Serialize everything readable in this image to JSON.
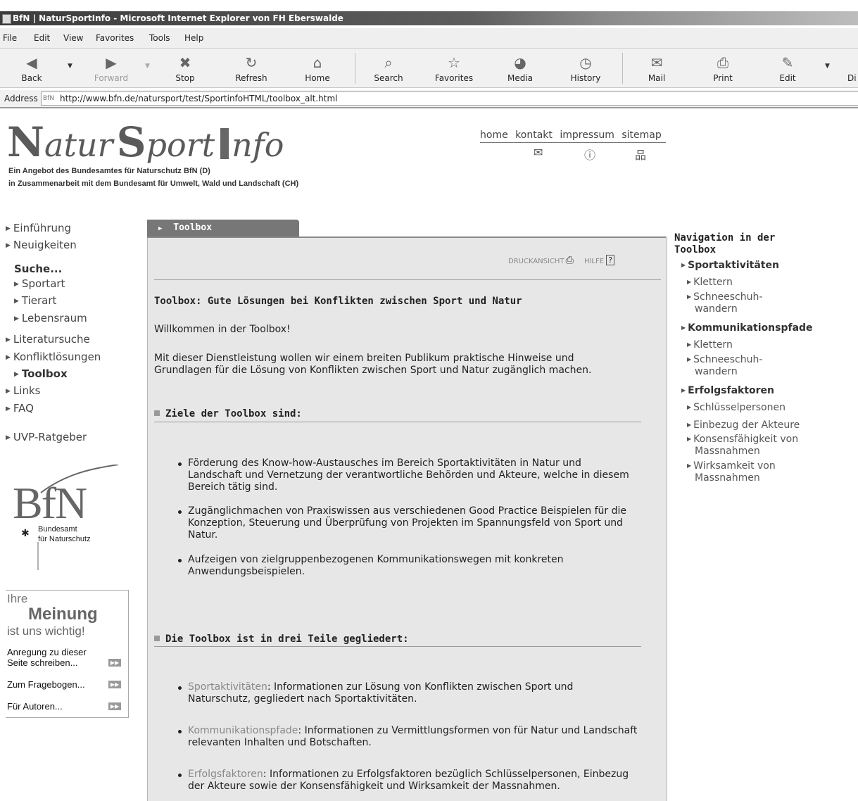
{
  "window": {
    "title": "BfN | NaturSportInfo - Microsoft Internet Explorer von FH Eberswalde"
  },
  "menu": [
    "File",
    "Edit",
    "View",
    "Favorites",
    "Tools",
    "Help"
  ],
  "toolbar": {
    "back": "Back",
    "forward": "Forward",
    "stop": "Stop",
    "refresh": "Refresh",
    "home": "Home",
    "search": "Search",
    "favorites": "Favorites",
    "media": "Media",
    "history": "History",
    "mail": "Mail",
    "print": "Print",
    "edit": "Edit",
    "discuss": "Di"
  },
  "address": {
    "label": "Address",
    "url": "http://www.bfn.de/natursport/test/SportinfoHTML/toolbox_alt.html"
  },
  "site": {
    "logo_n": "N",
    "logo_atur": "atur",
    "logo_s": "S",
    "logo_port": "port",
    "logo_i": "I",
    "logo_nfo": "nfo",
    "tagline1": "Ein Angebot des Bundesamtes für Naturschutz BfN (D)",
    "tagline2": "in Zusammenarbeit mit dem Bundesamt für Umwelt, Wald und Landschaft (CH)",
    "topnav": {
      "home": "home",
      "kontakt": "kontakt",
      "impressum": "impressum",
      "sitemap": "sitemap"
    }
  },
  "leftnav": {
    "einfuehrung": "Einführung",
    "neuigkeiten": "Neuigkeiten",
    "suche": "Suche...",
    "sportart": "Sportart",
    "tierart": "Tierart",
    "lebensraum": "Lebensraum",
    "literatursuche": "Literatursuche",
    "konfliktloesungen": "Konfliktlösungen",
    "toolbox": "Toolbox",
    "links": "Links",
    "faq": "FAQ",
    "uvp": "UVP-Ratgeber"
  },
  "bfn": {
    "letters": "BfN",
    "line1": "Bundesamt",
    "line2": "für Naturschutz"
  },
  "meinung": {
    "ihre": "Ihre",
    "meinung": "Meinung",
    "wichtig": "ist uns wichtig!",
    "anregung1": "Anregung zu dieser",
    "anregung2": "Seite schreiben...",
    "fragebogen": "Zum Fragebogen...",
    "autoren": "Für Autoren..."
  },
  "main": {
    "tab": "Toolbox",
    "druckansicht": "DRUCKANSICHT",
    "hilfe": "HILFE",
    "heading": "Toolbox: Gute Lösungen bei Konflikten zwischen Sport und Natur",
    "welcome": "Willkommen in der Toolbox!",
    "intro1": "Mit dieser Dienstleistung wollen wir einem breiten Publikum praktische Hinweise und",
    "intro2": "Grundlagen für die Lösung von Konflikten zwischen Sport und Natur zugänglich machen.",
    "ziele_head": "Ziele der Toolbox sind:",
    "ziele": [
      "Förderung des Know-how-Austausches im Bereich Sportaktivitäten in Natur und Landschaft und Vernetzung der verantwortliche Behörden und Akteure, welche in diesem Bereich tätig sind.",
      "Zugänglichmachen von Praxiswissen aus verschiedenen Good Practice Beispielen für die Konzeption, Steuerung und Überprüfung von Projekten im Spannungsfeld von Sport und Natur.",
      "Aufzeigen von zielgruppenbezogenen Kommunikationswegen mit konkreten Anwendungsbeispielen."
    ],
    "teile_head": "Die Toolbox ist in drei Teile gegliedert:",
    "teile": [
      {
        "link": "Sportaktivitäten",
        "text": ": Informationen zur Lösung von Konflikten zwischen Sport und Naturschutz, gegliedert nach Sportaktivitäten."
      },
      {
        "link": "Kommunikationspfade",
        "text": ": Informationen zu Vermittlungsformen von für Natur und Landschaft relevanten Inhalten und Botschaften."
      },
      {
        "link": "Erfolgsfaktoren",
        "text": ": Informationen zu Erfolgsfaktoren bezüglich Schlüsselpersonen, Einbezug der Akteure sowie der Konsensfähigkeit und Wirksamkeit der Massnahmen."
      }
    ]
  },
  "rightnav": {
    "title": "Navigation in der Toolbox",
    "sportaktivitaeten": "Sportaktivitäten",
    "klettern1": "Klettern",
    "schnee1a": "Schneeschuh-",
    "schnee1b": "wandern",
    "kommunikationspfade": "Kommunikationspfade",
    "klettern2": "Klettern",
    "schnee2a": "Schneeschuh-",
    "schnee2b": "wandern",
    "erfolgsfaktoren": "Erfolgsfaktoren",
    "schluessel": "Schlüsselpersonen",
    "einbezug": "Einbezug der Akteure",
    "konsens1": "Konsensfähigkeit von",
    "konsens2": "Massnahmen",
    "wirksam1": "Wirksamkeit von",
    "wirksam2": "Massnahmen"
  }
}
